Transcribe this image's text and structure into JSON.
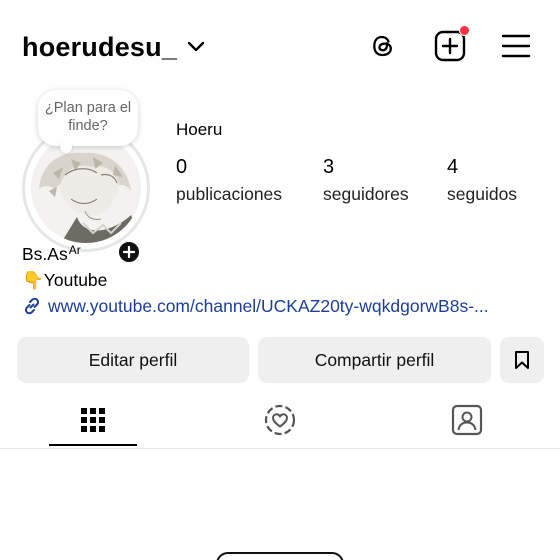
{
  "header": {
    "username": "hoerudesu_",
    "icons": [
      "chevron-down-icon",
      "threads-icon",
      "create-post-icon",
      "menu-icon"
    ],
    "notification_color": "#ff3040"
  },
  "profile": {
    "note": "¿Plan para el finde?",
    "display_name": "Hoeru",
    "stats": [
      {
        "value": "0",
        "label": "publicaciones"
      },
      {
        "value": "3",
        "label": "seguidores"
      },
      {
        "value": "4",
        "label": "seguidos"
      }
    ]
  },
  "bio": {
    "location": "Bs.As",
    "location_sup": "Ar",
    "line2_emoji": "👇",
    "line2_text": "Youtube",
    "link": "www.youtube.com/channel/UCKAZ20ty-wqkdgorwB8s-..."
  },
  "actions": {
    "edit": "Editar perfil",
    "share": "Compartir perfil",
    "save_icon": "bookmark-icon",
    "button_bg": "#efefef"
  },
  "tabs": {
    "items": [
      "grid-icon",
      "reels-heart-icon",
      "tagged-icon"
    ],
    "active_index": 0
  },
  "colors": {
    "link": "#1c3f95",
    "text": "#000000"
  }
}
